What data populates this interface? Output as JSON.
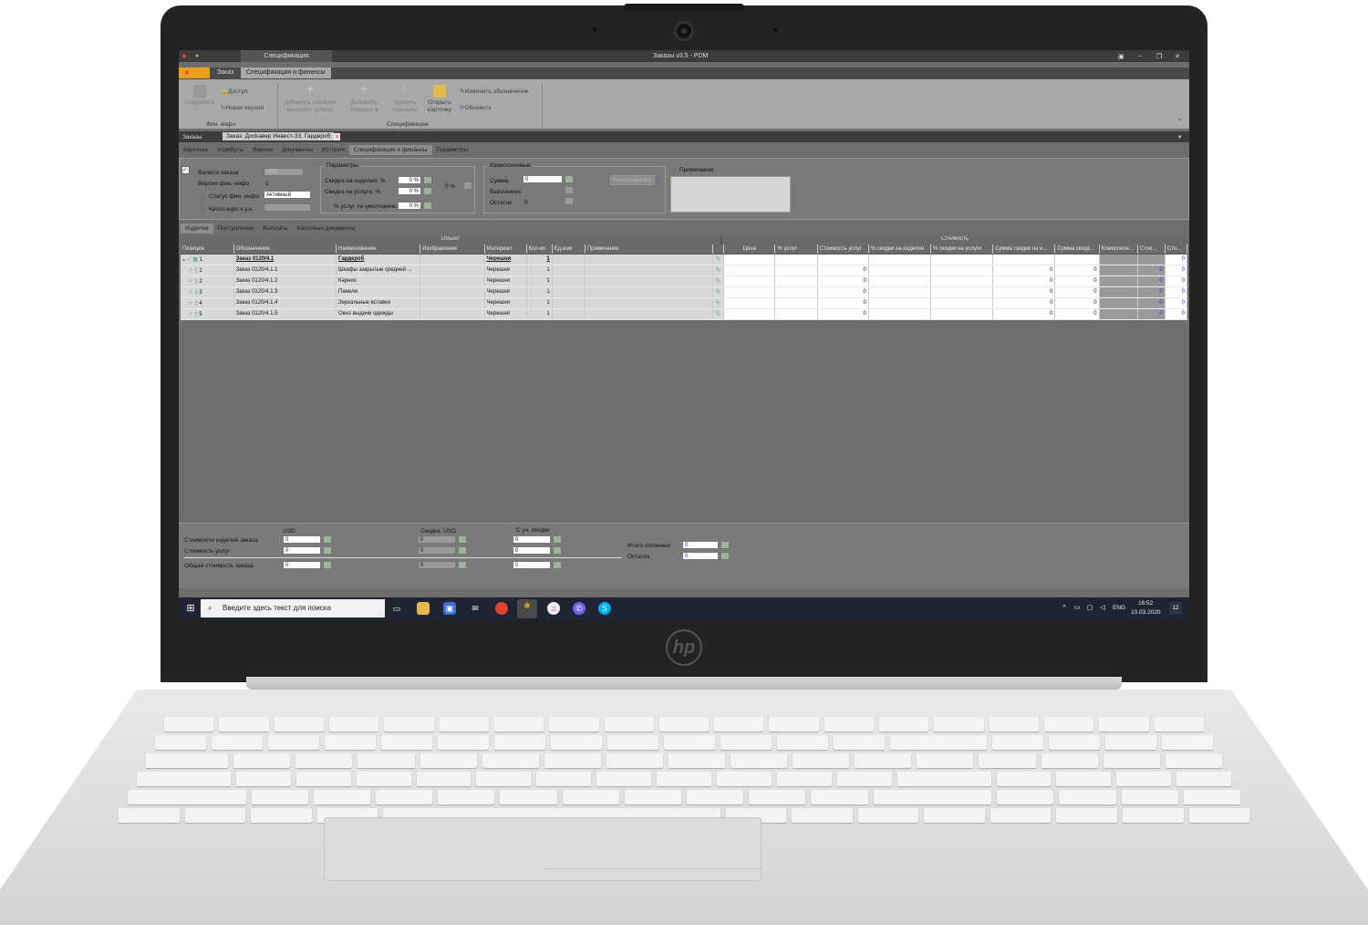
{
  "window": {
    "title": "Заказы v3.5 - PDM",
    "context_tab": "Спецификация",
    "menu_tabs": [
      "Заказ",
      "Спецификация и финансы"
    ]
  },
  "ribbon": {
    "save": "Сохранить",
    "access": "Доступ",
    "new_version": "Новая версия",
    "group_fin": "Фин. инфо",
    "add_top": "Добавить позицию верхнего уровня",
    "add_in": "Добавить позицию в",
    "delete_pos": "Удалить позицию",
    "open_card": "Открыть карточку",
    "rename": "Изменить обозначение",
    "refresh": "Обновить",
    "group_spec": "Спецификация"
  },
  "doc_tabs": [
    "Заказы",
    "Заказ: Дисkавер Инвест-33. Гардероб"
  ],
  "sub_tabs": [
    "Карточка",
    "Атрибуты",
    "Версии",
    "Документы",
    "История",
    "Спецификация и финансы",
    "Параметры"
  ],
  "fin": {
    "currency_label": "Валюта заказа",
    "currency": "USD",
    "version_label": "Версия фин. инфо",
    "version": "1",
    "status_label": "Статус фин. инфо",
    "status": "Активный",
    "rate_label": "Кросс-курс к у.е."
  },
  "params": {
    "title": "Параметры",
    "disc_items": "Скидка на изделия, %",
    "disc_items_val": "0 %",
    "disc_services": "Скидка на услуги, %",
    "disc_services_val": "0 %",
    "pct_total": "0 %",
    "services_default": "% услуг по-умолчанию",
    "services_default_val": "0 %"
  },
  "commission": {
    "title": "Комиссионные",
    "sum": "Сумма",
    "sum_val": "0",
    "paid": "Выплачено",
    "rest": "Остаток",
    "rest_val": "0",
    "distribute": "Распределить"
  },
  "notes_title": "Примечание",
  "lower_tabs": [
    "Изделия",
    "Поступления",
    "Выплаты",
    "Кассовые документы"
  ],
  "grid": {
    "group_object": "Объект",
    "group_cost": "Стоимость",
    "columns_left": [
      "Позиция",
      "Обозначение",
      "Наименование",
      "Изображение",
      "Материал",
      "Кол-во",
      "Ед.изм",
      "Примечание"
    ],
    "columns_right": [
      "Цена",
      "% услуг",
      "Стоимость услуг",
      "% скидки на изделия",
      "% скидки на услуги",
      "Сумма скидки на и...",
      "Сумма скидк...",
      "Комиссион...",
      "Стои...",
      "Сто..."
    ],
    "rows": [
      {
        "pos": "1",
        "code": "Заказ 0120/4.1",
        "name": "Гардероб",
        "mat": "Черешня",
        "qty": "1",
        "v1": "",
        "v2": "",
        "v3": "",
        "v4": "",
        "v5": "0",
        "bold": true
      },
      {
        "pos": "1",
        "code": "Заказ 0120/4.1.1",
        "name": "Шкафы закрытые средней ...",
        "mat": "Черешня",
        "qty": "1",
        "v1": "0",
        "v2": "0",
        "v3": "0",
        "v4": "0",
        "v5": "0"
      },
      {
        "pos": "2",
        "code": "Заказ 0120/4.1.2",
        "name": "Карниз",
        "mat": "Черешня",
        "qty": "1",
        "v1": "0",
        "v2": "0",
        "v3": "0",
        "v4": "0",
        "v5": "0"
      },
      {
        "pos": "3",
        "code": "Заказ 0120/4.1.3",
        "name": "Панели",
        "mat": "Черешня",
        "qty": "1",
        "v1": "0",
        "v2": "0",
        "v3": "0",
        "v4": "0",
        "v5": "0"
      },
      {
        "pos": "4",
        "code": "Заказ 0120/4.1.4",
        "name": "Зеркальные вставки",
        "mat": "Черешня",
        "qty": "1",
        "v1": "0",
        "v2": "0",
        "v3": "0",
        "v4": "0",
        "v5": "0"
      },
      {
        "pos": "5",
        "code": "Заказ 0120/4.1.5",
        "name": "Окно выдачи одежды",
        "mat": "Черешня",
        "qty": "1",
        "v1": "0",
        "v2": "0",
        "v3": "0",
        "v4": "0",
        "v5": "0"
      }
    ]
  },
  "totals": {
    "usd": "USD",
    "discount_usd": "Скидка, USD",
    "with_discount": "С уч. скидки",
    "items_cost": "Стоимости изделий заказа",
    "services_cost": "Стоимость услуг",
    "total_cost": "Общая стоимость заказа",
    "paid_total": "Итого оплачено",
    "rest": "Остаток",
    "zero": "0"
  },
  "taskbar": {
    "search_placeholder": "Введите здесь текст для поиска",
    "lang": "ENG",
    "time": "16:52",
    "date": "10.03.2020",
    "notif": "12"
  },
  "laptop": {
    "brand": "hp"
  }
}
